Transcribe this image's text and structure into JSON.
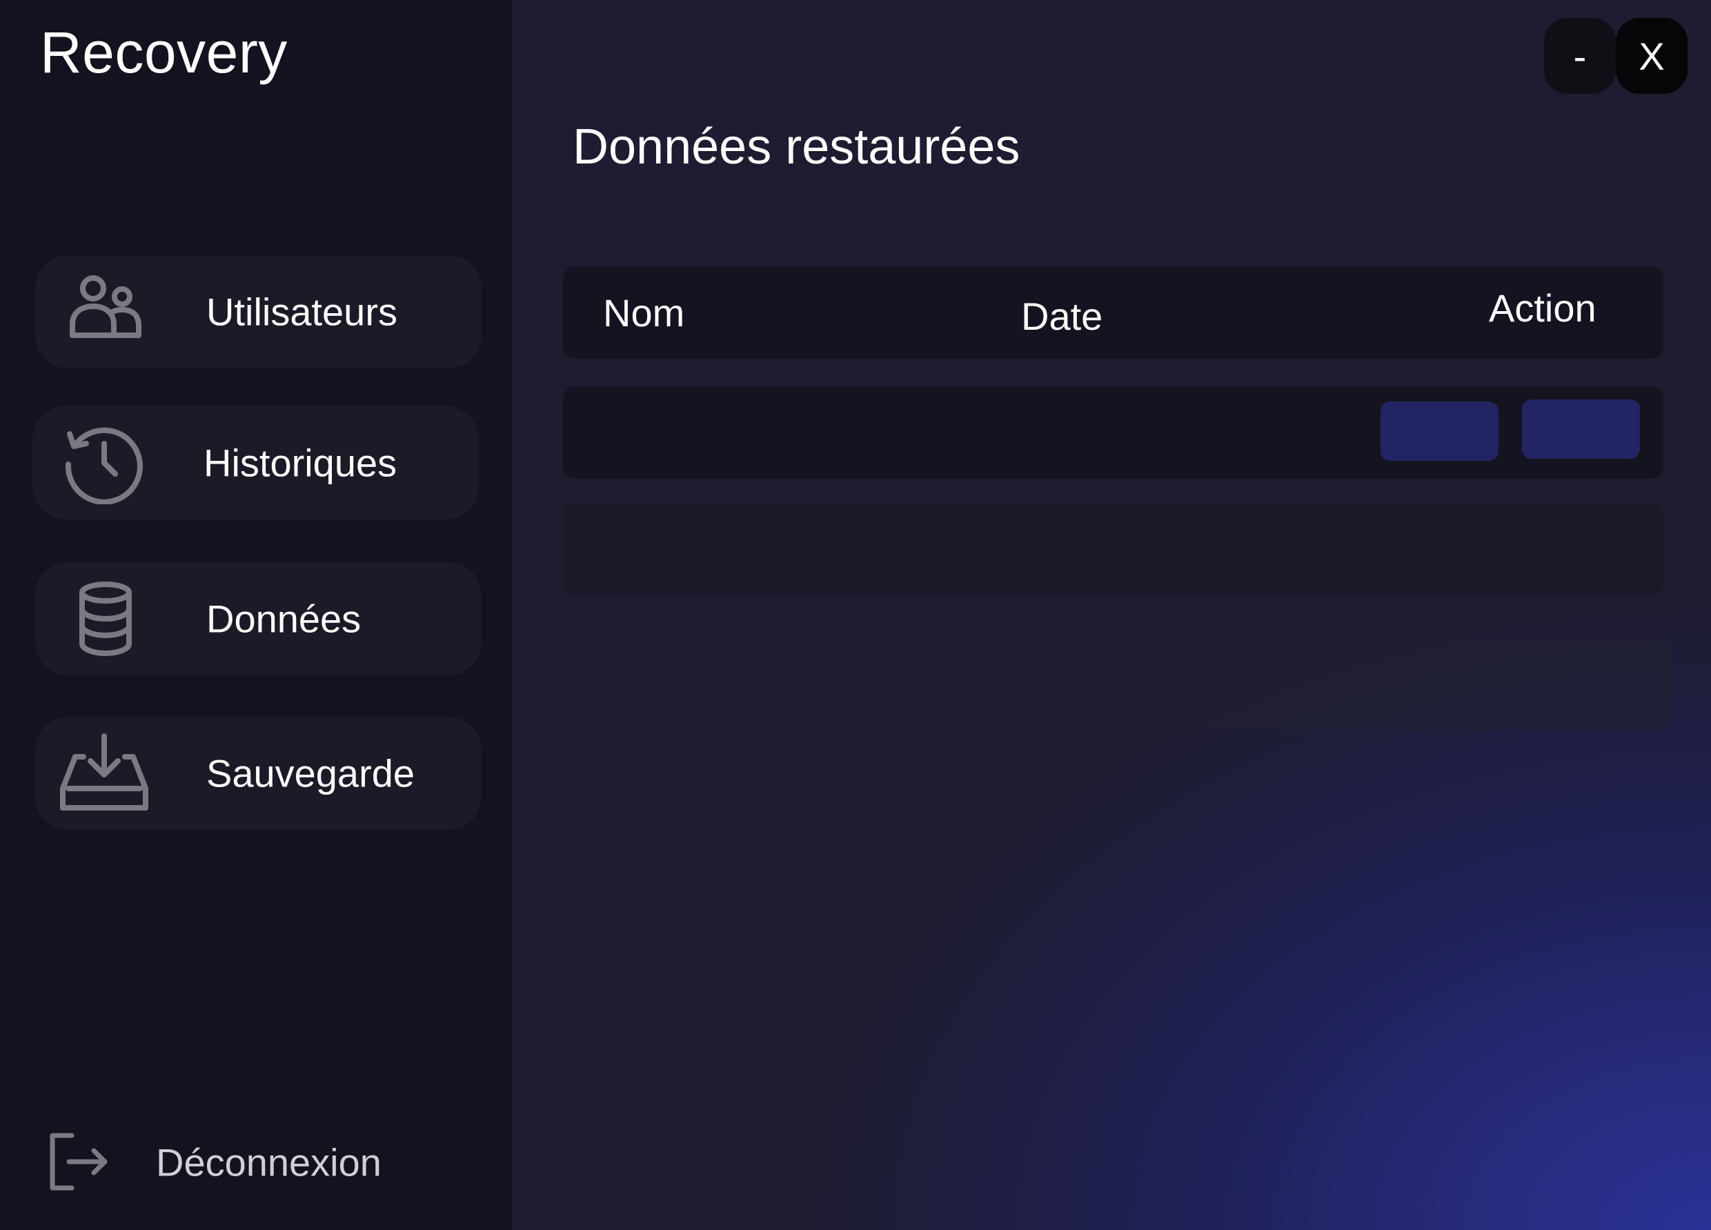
{
  "app": {
    "title": "Recovery"
  },
  "window_controls": {
    "minimize_label": "-",
    "close_label": "X"
  },
  "sidebar": {
    "items": [
      {
        "label": "Utilisateurs",
        "icon": "users-icon"
      },
      {
        "label": "Historiques",
        "icon": "history-icon"
      },
      {
        "label": "Données",
        "icon": "database-icon"
      },
      {
        "label": "Sauvegarde",
        "icon": "download-inbox-icon"
      }
    ],
    "logout": {
      "label": "Déconnexion",
      "icon": "logout-icon"
    }
  },
  "main": {
    "title": "Données restaurées",
    "table": {
      "columns": [
        "Nom",
        "Date",
        "Action"
      ]
    }
  },
  "colors": {
    "sidebar_bg": "#131320",
    "nav_item_bg": "#1b1b28",
    "main_bg": "#1d1c31",
    "accent_gradient": "#2b3296",
    "action_button": "#232464",
    "icon_gray": "#7a7a82"
  }
}
